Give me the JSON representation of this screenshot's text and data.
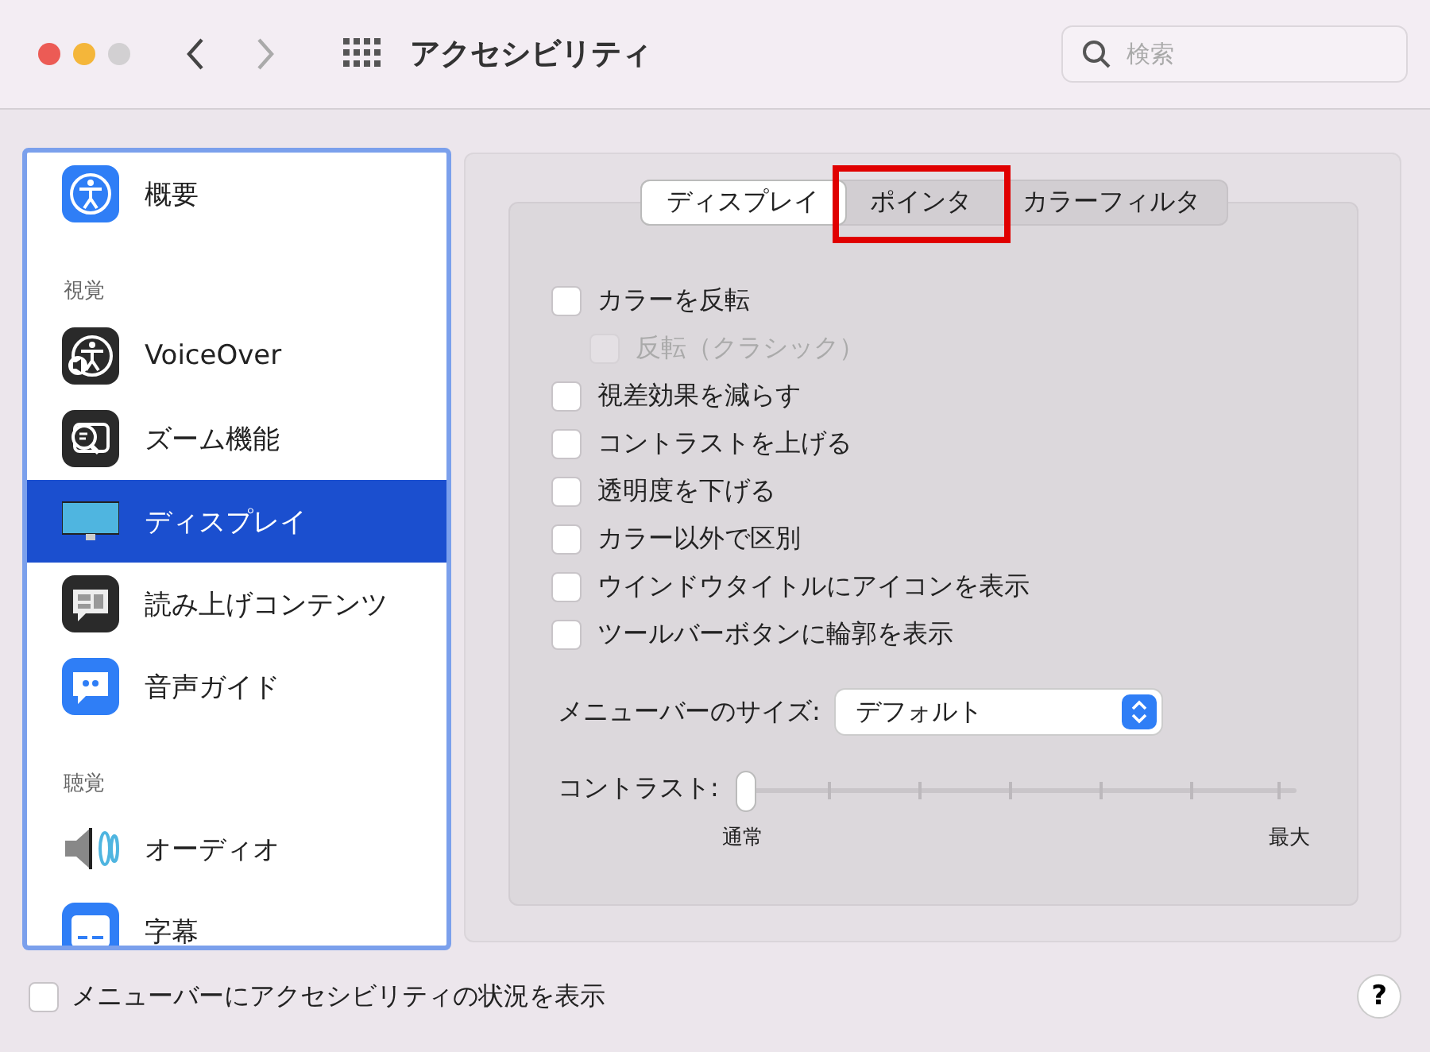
{
  "window": {
    "title": "アクセシビリティ"
  },
  "nav": {
    "back": {
      "disabled": false
    },
    "forward": {
      "disabled": true
    }
  },
  "search": {
    "placeholder": "検索"
  },
  "sidebar": {
    "items": [
      {
        "kind": "item",
        "label": "概要",
        "selected": false
      },
      {
        "kind": "header",
        "label": "視覚"
      },
      {
        "kind": "item",
        "label": "VoiceOver",
        "selected": false
      },
      {
        "kind": "item",
        "label": "ズーム機能",
        "selected": false
      },
      {
        "kind": "item",
        "label": "ディスプレイ",
        "selected": true
      },
      {
        "kind": "item",
        "label": "読み上げコンテンツ",
        "selected": false
      },
      {
        "kind": "item",
        "label": "音声ガイド",
        "selected": false
      },
      {
        "kind": "header",
        "label": "聴覚"
      },
      {
        "kind": "item",
        "label": "オーディオ",
        "selected": false
      },
      {
        "kind": "item",
        "label": "字幕",
        "selected": false
      }
    ]
  },
  "tabs": [
    {
      "label": "ディスプレイ",
      "selected": true,
      "highlighted": false
    },
    {
      "label": "ポインタ",
      "selected": false,
      "highlighted": true
    },
    {
      "label": "カラーフィルタ",
      "selected": false,
      "highlighted": false
    }
  ],
  "options": [
    {
      "label": "カラーを反転",
      "checked": false,
      "disabled": false,
      "children": [
        {
          "label": "反転（クラシック）",
          "checked": false,
          "disabled": true
        }
      ]
    },
    {
      "label": "視差効果を減らす",
      "checked": false,
      "disabled": false
    },
    {
      "label": "コントラストを上げる",
      "checked": false,
      "disabled": false
    },
    {
      "label": "透明度を下げる",
      "checked": false,
      "disabled": false
    },
    {
      "label": "カラー以外で区別",
      "checked": false,
      "disabled": false
    },
    {
      "label": "ウインドウタイトルにアイコンを表示",
      "checked": false,
      "disabled": false
    },
    {
      "label": "ツールバーボタンに輪郭を表示",
      "checked": false,
      "disabled": false
    }
  ],
  "menu_bar_size": {
    "label": "メニューバーのサイズ:",
    "value": "デフォルト"
  },
  "contrast": {
    "label": "コントラスト:",
    "level": 0,
    "min_label": "通常",
    "max_label": "最大"
  },
  "footer": {
    "checkbox": {
      "label": "メニューバーにアクセシビリティの状況を表示",
      "checked": false
    },
    "help": "?"
  }
}
